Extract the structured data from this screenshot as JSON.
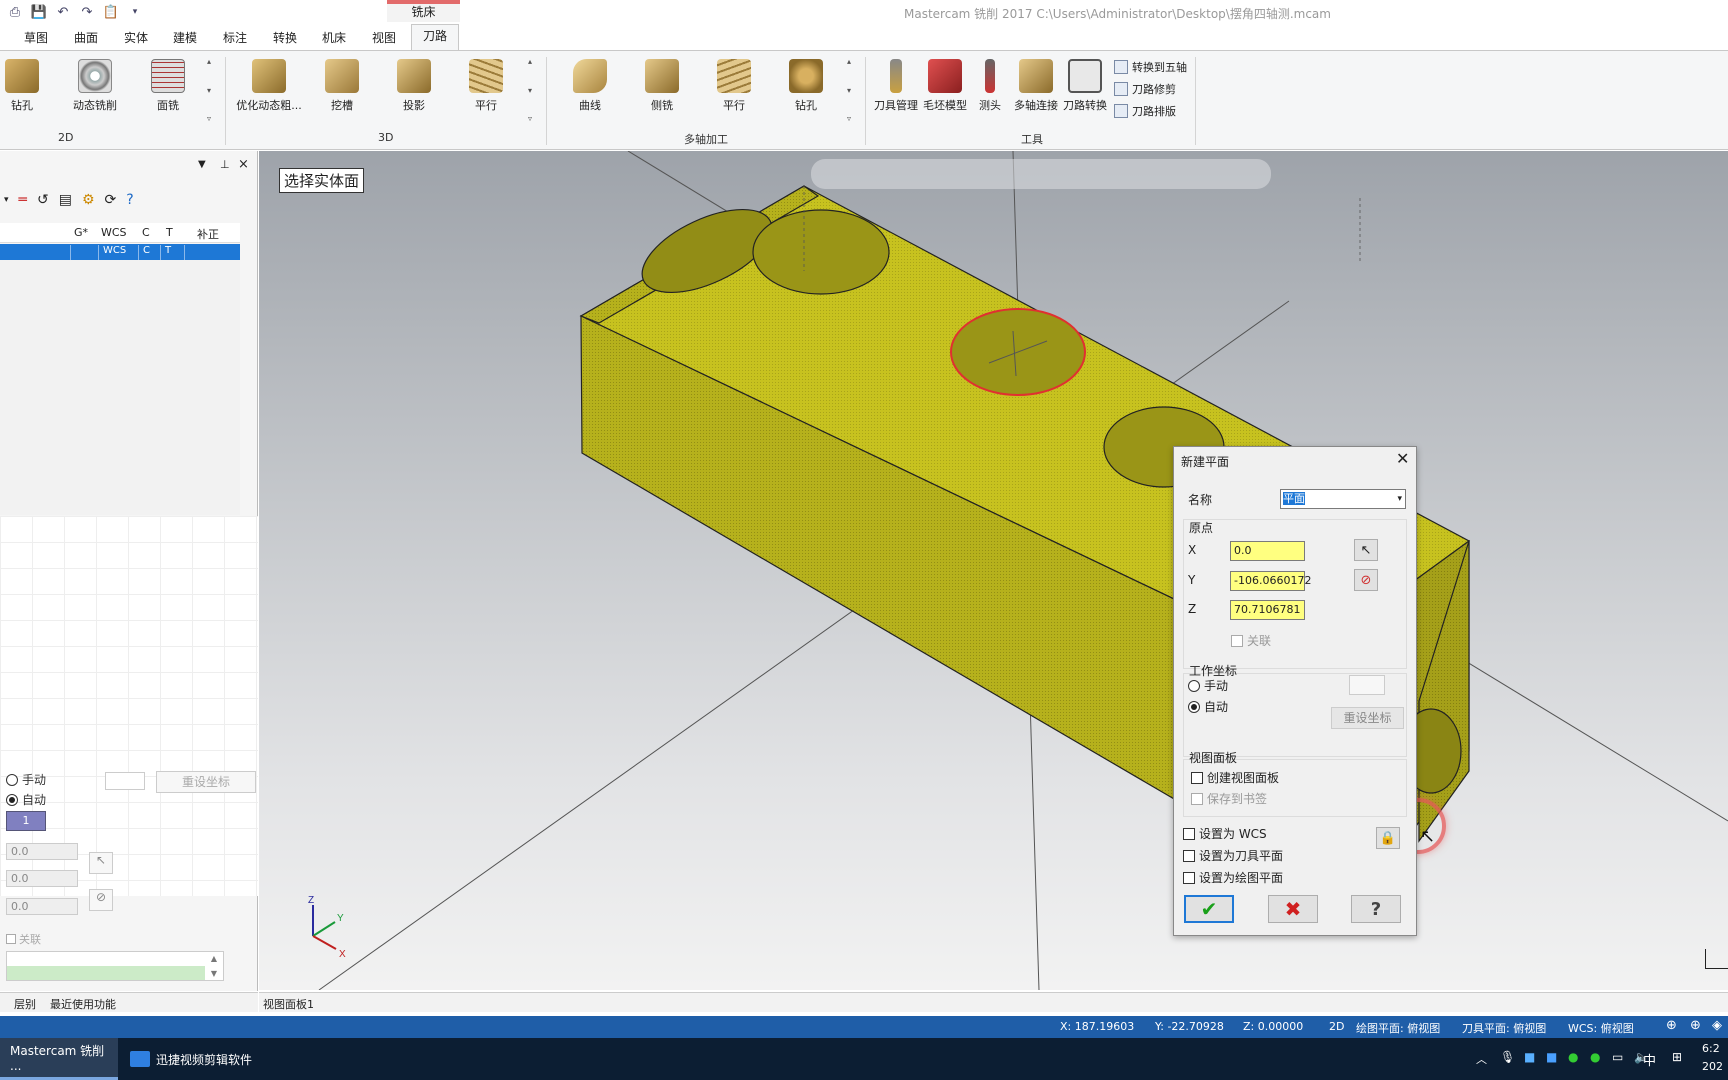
{
  "window": {
    "title": "Mastercam 铣削 2017  C:\\Users\\Administrator\\Desktop\\摆角四轴测.mcam",
    "context_tab": "铣床"
  },
  "ribbon": {
    "tabs": [
      "草图",
      "曲面",
      "实体",
      "建模",
      "标注",
      "转换",
      "机床",
      "视图",
      "刀路"
    ],
    "active_tab": "刀路",
    "groups": {
      "g2d": {
        "label": "2D",
        "buttons": [
          "钻孔",
          "动态铣削",
          "面铣"
        ]
      },
      "g3d": {
        "label": "3D",
        "buttons": [
          "优化动态粗...",
          "挖槽",
          "投影",
          "平行"
        ]
      },
      "gmulti": {
        "label": "多轴加工",
        "buttons": [
          "曲线",
          "侧铣",
          "平行",
          "钻孔"
        ]
      },
      "gtools": {
        "label": "工具",
        "buttons": [
          "刀具管理",
          "毛坯模型",
          "测头",
          "多轴连接",
          "刀路转换"
        ],
        "small": [
          "转换到五轴",
          "刀路修剪",
          "刀路排版"
        ]
      }
    }
  },
  "left_panel": {
    "grid_headers": [
      "G*",
      "WCS",
      "C",
      "T",
      "补正"
    ],
    "selected_row": [
      "",
      "WCS",
      "C",
      "T",
      ""
    ],
    "radio_manual": "手动",
    "radio_auto": "自动",
    "reset_button": "重设坐标",
    "index_value": "1",
    "inputs": [
      "0.0",
      "0.0",
      "0.0"
    ],
    "assoc_label": "关联",
    "bottom_tabs": [
      "层别",
      "最近使用功能"
    ]
  },
  "viewport": {
    "prompt": "选择实体面",
    "view_tab": "视图面板1",
    "axis_labels": {
      "x": "X",
      "y": "Y",
      "z": "Z"
    }
  },
  "dialog": {
    "title": "新建平面",
    "name_label": "名称",
    "name_value": "平面",
    "origin_label": "原点",
    "x_label": "X",
    "x_value": "0.0",
    "y_label": "Y",
    "y_value": "-106.0660172",
    "z_label": "Z",
    "z_value": "70.7106781",
    "assoc_label": "关联",
    "wcs_group": "工作坐标",
    "manual": "手动",
    "auto": "自动",
    "reset_button": "重设坐标",
    "view_group": "视图面板",
    "create_view": "创建视图面板",
    "save_bookmark": "保存到书签",
    "set_wcs": "设置为 WCS",
    "set_tool_plane": "设置为刀具平面",
    "set_draw_plane": "设置为绘图平面"
  },
  "coord_bar": {
    "x": "X:   187.19603",
    "y": "Y:   -22.70928",
    "z": "Z:   0.00000",
    "mode": "2D",
    "draw_plane": "绘图平面: 俯视图",
    "tool_plane": "刀具平面: 俯视图",
    "wcs": "WCS: 俯视图"
  },
  "taskbar": {
    "items": [
      "Mastercam 铣削 ...",
      "迅捷视频剪辑软件"
    ],
    "ime": "中",
    "clock_time": "6:2",
    "clock_date": "202"
  },
  "colors": {
    "part": "#c7c21f",
    "accent": "#1e78d6",
    "highlight": "#e03030",
    "field": "#ffff80"
  }
}
